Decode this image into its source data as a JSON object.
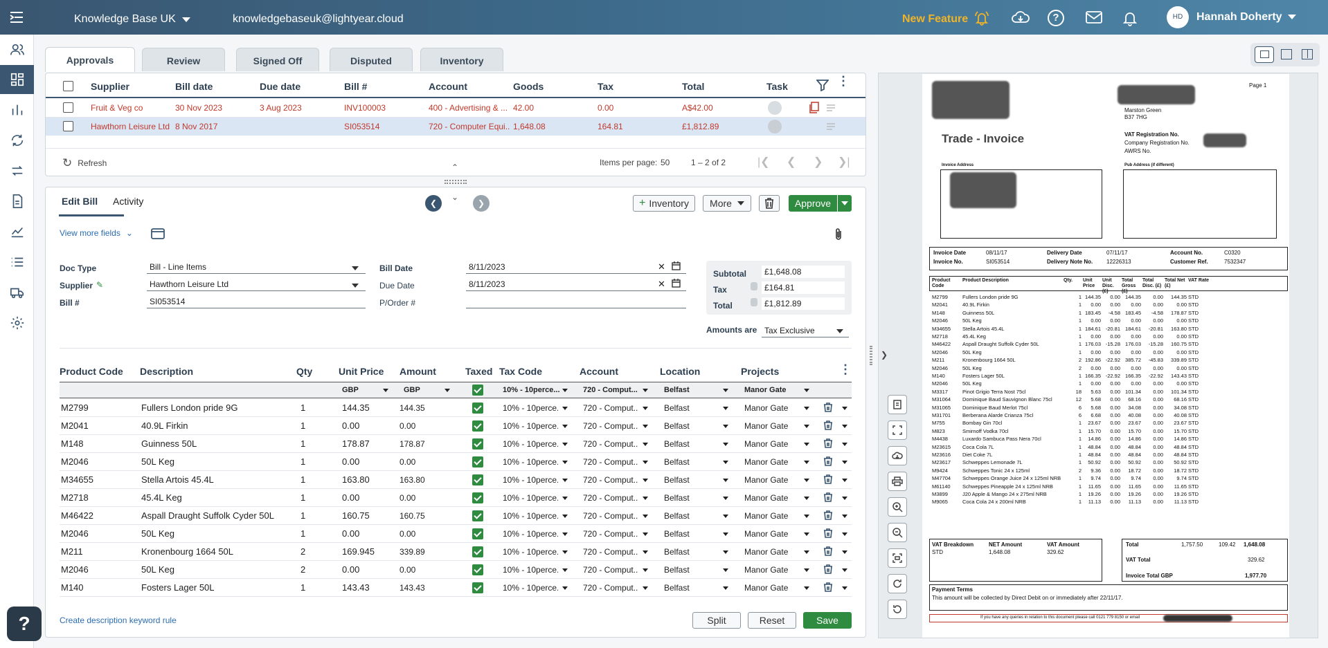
{
  "topbar": {
    "org": "Knowledge Base UK",
    "email": "knowledgebaseuk@lightyear.cloud",
    "new_feature": "New Feature",
    "user_initials": "HD",
    "user_name": "Hannah Doherty"
  },
  "tabs": [
    "Approvals",
    "Review",
    "Signed Off",
    "Disputed",
    "Inventory"
  ],
  "list": {
    "headers": [
      "Supplier",
      "Bill date",
      "Due date",
      "Bill #",
      "Account",
      "Goods",
      "Tax",
      "Total",
      "Task"
    ],
    "rows": [
      {
        "supplier": "Fruit & Veg co",
        "bill_date": "30 Nov 2023",
        "due_date": "3 Aug 2023",
        "bill_no": "INV100003",
        "account": "400 - Advertising & ...",
        "goods": "42.00",
        "tax": "0.00",
        "total": "A$42.00"
      },
      {
        "supplier": "Hawthorn Leisure Ltd",
        "bill_date": "8 Nov 2017",
        "due_date": "",
        "bill_no": "SI053514",
        "account": "720 - Computer Equi...",
        "goods": "1,648.08",
        "tax": "164.81",
        "total": "£1,812.89"
      }
    ],
    "refresh": "Refresh",
    "items_per_page_label": "Items per page:",
    "items_per_page": "50",
    "range": "1 – 2 of 2"
  },
  "edit": {
    "tab_edit": "Edit Bill",
    "tab_activity": "Activity",
    "inventory_btn": "Inventory",
    "more_btn": "More",
    "approve_btn": "Approve",
    "view_more": "View more fields",
    "doc_type_label": "Doc Type",
    "doc_type": "Bill - Line Items",
    "supplier_label": "Supplier",
    "supplier": "Hawthorn Leisure Ltd",
    "bill_no_label": "Bill #",
    "bill_no": "SI053514",
    "bill_date_label": "Bill Date",
    "bill_date": "8/11/2023",
    "due_date_label": "Due Date",
    "due_date": "8/11/2023",
    "porder_label": "P/Order #",
    "subtotal_label": "Subtotal",
    "subtotal": "£1,648.08",
    "tax_label": "Tax",
    "tax": "£164.81",
    "total_label": "Total",
    "total": "£1,812.89",
    "amounts_label": "Amounts are",
    "amounts": "Tax Exclusive",
    "split": "Split",
    "reset": "Reset",
    "save": "Save",
    "keyword_rule": "Create description keyword rule"
  },
  "lines": {
    "headers": [
      "Product Code",
      "Description",
      "Qty",
      "Unit Price",
      "Amount",
      "Taxed",
      "Tax Code",
      "Account",
      "Location",
      "Projects"
    ],
    "defaults": {
      "unit_price": "GBP",
      "amount": "GBP",
      "tax_code": "10% - 10perce...",
      "account": "720 - Comput...",
      "location": "Belfast",
      "projects": "Manor Gate"
    },
    "row_tax": "10% - 10perce...",
    "row_account": "720 - Comput...",
    "row_location": "Belfast",
    "row_project": "Manor Gate",
    "rows": [
      {
        "code": "M2799",
        "desc": "Fullers London pride 9G",
        "qty": "1",
        "price": "144.35",
        "amount": "144.35"
      },
      {
        "code": "M2041",
        "desc": "40.9L Firkin",
        "qty": "1",
        "price": "0.00",
        "amount": "0.00"
      },
      {
        "code": "M148",
        "desc": "Guinness  50L",
        "qty": "1",
        "price": "178.87",
        "amount": "178.87"
      },
      {
        "code": "M2046",
        "desc": "50L Keg",
        "qty": "1",
        "price": "0.00",
        "amount": "0.00"
      },
      {
        "code": "M34655",
        "desc": "Stella Artois  45.4L",
        "qty": "1",
        "price": "163.80",
        "amount": "163.80"
      },
      {
        "code": "M2718",
        "desc": "45.4L Keg",
        "qty": "1",
        "price": "0.00",
        "amount": "0.00"
      },
      {
        "code": "M46422",
        "desc": "Aspall Draught Suffolk Cyder 50L",
        "qty": "1",
        "price": "160.75",
        "amount": "160.75"
      },
      {
        "code": "M2046",
        "desc": "50L Keg",
        "qty": "1",
        "price": "0.00",
        "amount": "0.00"
      },
      {
        "code": "M211",
        "desc": "Kronenbourg 1664  50L",
        "qty": "2",
        "price": "169.945",
        "amount": "339.89"
      },
      {
        "code": "M2046",
        "desc": "50L Keg",
        "qty": "2",
        "price": "0.00",
        "amount": "0.00"
      },
      {
        "code": "M140",
        "desc": "Fosters Lager  50L",
        "qty": "1",
        "price": "143.43",
        "amount": "143.43"
      }
    ]
  },
  "invoice": {
    "page": "Page  1",
    "title": "Trade - Invoice",
    "addr1": "Marston Green",
    "addr2": "B37 7HG",
    "vat_reg": "VAT Registration No.",
    "company_reg": "Company Registration No.",
    "awrs": "AWRS No.",
    "invoice_address": "Invoice Address",
    "pub_address": "Pub Address (if different)",
    "invoice_date_label": "Invoice Date",
    "invoice_date": "08/11/17",
    "invoice_no_label": "Invoice No.",
    "invoice_no": "SI053514",
    "delivery_date_label": "Delivery Date",
    "delivery_date": "07/11/17",
    "delivery_note_label": "Delivery Note No.",
    "delivery_note": "12226313",
    "account_label": "Account No.",
    "account": "C0320",
    "customer_ref_label": "Customer Ref.",
    "customer_ref": "7532347",
    "col_headers": [
      "Product Code",
      "Product Description",
      "Qty.",
      "Unit Price",
      "Unit Disc. (£)",
      "Total Gross (£)",
      "Total Disc. (£)",
      "Total Net (£)",
      "VAT Rate"
    ],
    "rows": [
      [
        "M2799",
        "Fullers London pride 9G",
        "1",
        "144.35",
        "0.00",
        "144.35",
        "0.00",
        "144.35",
        "STD"
      ],
      [
        "M2041",
        "40.9L Firkin",
        "1",
        "0.00",
        "0.00",
        "0.00",
        "0.00",
        "0.00",
        "STD"
      ],
      [
        "M148",
        "Guinness  50L",
        "1",
        "183.45",
        "-4.58",
        "183.45",
        "-4.58",
        "178.87",
        "STD"
      ],
      [
        "M2046",
        "50L Keg",
        "1",
        "0.00",
        "0.00",
        "0.00",
        "0.00",
        "0.00",
        "STD"
      ],
      [
        "M34655",
        "Stella Artois  45.4L",
        "1",
        "184.61",
        "-20.81",
        "184.61",
        "-20.81",
        "163.80",
        "STD"
      ],
      [
        "M2718",
        "45.4L Keg",
        "1",
        "0.00",
        "0.00",
        "0.00",
        "0.00",
        "0.00",
        "STD"
      ],
      [
        "M46422",
        "Aspall Draught Suffolk Cyder 50L",
        "1",
        "176.03",
        "-15.28",
        "176.03",
        "-15.28",
        "160.75",
        "STD"
      ],
      [
        "M2046",
        "50L Keg",
        "1",
        "0.00",
        "0.00",
        "0.00",
        "0.00",
        "0.00",
        "STD"
      ],
      [
        "M211",
        "Kronenbourg 1664  50L",
        "2",
        "192.86",
        "-22.92",
        "385.72",
        "-45.83",
        "339.89",
        "STD"
      ],
      [
        "M2046",
        "50L Keg",
        "2",
        "0.00",
        "0.00",
        "0.00",
        "0.00",
        "0.00",
        "STD"
      ],
      [
        "M140",
        "Fosters Lager  50L",
        "1",
        "166.35",
        "-22.92",
        "166.35",
        "-22.92",
        "143.43",
        "STD"
      ],
      [
        "M2046",
        "50L Keg",
        "1",
        "0.00",
        "0.00",
        "0.00",
        "0.00",
        "0.00",
        "STD"
      ],
      [
        "M3317",
        "Pinot Grigio Terra Nost  75cl",
        "18",
        "5.63",
        "0.00",
        "101.34",
        "0.00",
        "101.34",
        "STD"
      ],
      [
        "M31064",
        "Dominique Baud Sauvignon Blanc  75cl",
        "12",
        "5.68",
        "0.00",
        "68.16",
        "0.00",
        "68.16",
        "STD"
      ],
      [
        "M31065",
        "Dominique Baud Merlot  75cl",
        "6",
        "5.68",
        "0.00",
        "34.08",
        "0.00",
        "34.08",
        "STD"
      ],
      [
        "M31701",
        "Berberana Alarde Crianza  75cl",
        "6",
        "6.68",
        "0.00",
        "40.08",
        "0.00",
        "40.08",
        "STD"
      ],
      [
        "M755",
        "Bombay Gin  70cl",
        "1",
        "23.67",
        "0.00",
        "23.67",
        "0.00",
        "23.67",
        "STD"
      ],
      [
        "M823",
        "Smirnoff Vodka  70cl",
        "1",
        "15.70",
        "0.00",
        "15.70",
        "0.00",
        "15.70",
        "STD"
      ],
      [
        "M4438",
        "Luxardo Sambuca Pass Nera  70cl",
        "1",
        "14.86",
        "0.00",
        "14.86",
        "0.00",
        "14.86",
        "STD"
      ],
      [
        "M23615",
        "Coca Cola  7L",
        "1",
        "48.84",
        "0.00",
        "48.84",
        "0.00",
        "48.84",
        "STD"
      ],
      [
        "M23616",
        "Diet Coke  7L",
        "1",
        "48.84",
        "0.00",
        "48.84",
        "0.00",
        "48.84",
        "STD"
      ],
      [
        "M23617",
        "Schweppes Lemonade  7L",
        "1",
        "50.92",
        "0.00",
        "50.92",
        "0.00",
        "50.92",
        "STD"
      ],
      [
        "M9424",
        "Schweppes Tonic 24 x 125ml",
        "2",
        "9.36",
        "0.00",
        "18.72",
        "0.00",
        "18.72",
        "STD"
      ],
      [
        "M47704",
        "Schweppes Orange Juice  24 x 125ml NRB",
        "1",
        "9.74",
        "0.00",
        "9.74",
        "0.00",
        "9.74",
        "STD"
      ],
      [
        "M61140",
        "Schweppes Pineapple  24 x 125ml NRB",
        "1",
        "11.65",
        "0.00",
        "11.65",
        "0.00",
        "11.65",
        "STD"
      ],
      [
        "M3899",
        "J20 Apple & Mango  24 x 275ml NRB",
        "1",
        "19.26",
        "0.00",
        "19.26",
        "0.00",
        "19.26",
        "STD"
      ],
      [
        "M9065",
        "Coca Cola  24 x 200ml NRB",
        "1",
        "11.13",
        "0.00",
        "11.13",
        "0.00",
        "11.13",
        "STD"
      ]
    ],
    "vat_breakdown": "VAT Breakdown",
    "net_amount_label": "NET Amount",
    "vat_amount_label": "VAT Amount",
    "vat_code": "STD",
    "net_amount": "1,648.08",
    "vat_amount": "329.62",
    "total_label": "Total",
    "total_a": "1,757.50",
    "total_b": "109.42",
    "total_c": "1,648.08",
    "vat_total_label": "VAT Total",
    "vat_total": "329.62",
    "invoice_total_label": "Invoice Total GBP",
    "invoice_total": "1,977.70",
    "payment_terms": "Payment Terms",
    "payment_text": "This amount will be collected by Direct Debit  on or immediately after 22/11/17.",
    "footer": "If you have any queries in relation to this document please call 0121 779 8150 or email"
  },
  "colors": {
    "accent": "#3a5670",
    "green": "#2e8b3f",
    "red": "#c0392b",
    "new_feature": "#f0b429"
  }
}
